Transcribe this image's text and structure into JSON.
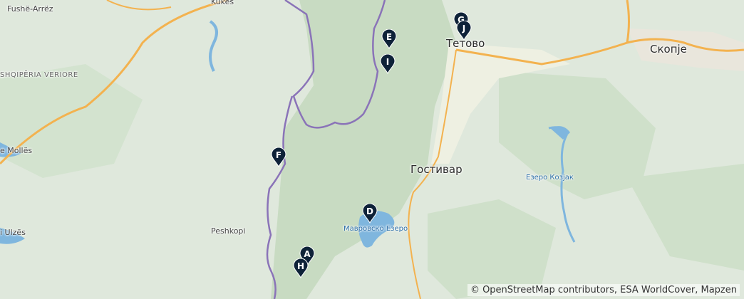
{
  "places": {
    "tetovo": "Тетово",
    "skopje": "Скопје",
    "gostivar": "Гостивар",
    "mavrovo_lake": "Мавровско Езеро",
    "kozjak_lake": "Езеро Козјак",
    "peshkopi": "Peshkopi",
    "kukes": "Kukës",
    "fushe_arrez": "Fushë-Arrëz",
    "shqiperia_veriore": "SHQIPËRIA VERIORE",
    "molles": "e Mollës",
    "ulzes": "i Ulzës"
  },
  "markers": [
    {
      "id": "A",
      "label": "A"
    },
    {
      "id": "D",
      "label": "D"
    },
    {
      "id": "E",
      "label": "E"
    },
    {
      "id": "F",
      "label": "F"
    },
    {
      "id": "G",
      "label": "G"
    },
    {
      "id": "H",
      "label": "H"
    },
    {
      "id": "I",
      "label": "I"
    },
    {
      "id": "J",
      "label": "J"
    }
  ],
  "attribution": "© OpenStreetMap contributors, ESA WorldCover, Mapzen",
  "colors": {
    "terrain": "#dfe8dc",
    "forest": "#c9dcc4",
    "valley": "#eef0e2",
    "water": "#7fb6de",
    "border": "#8a73b8",
    "motorway": "#f3b24f",
    "marker": "#0e2238"
  }
}
